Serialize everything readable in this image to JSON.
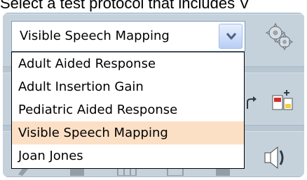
{
  "caption": "Select a test protocol that includes V",
  "protocol_select": {
    "value": "Visible Speech Mapping",
    "options": [
      "Adult Aided Response",
      "Adult Insertion Gain",
      "Pediatric Aided Response",
      "Visible Speech Mapping",
      "Joan Jones"
    ],
    "selected_index": 3
  },
  "icons": {
    "settings": "gear-icon",
    "dropdown": "chevron-down-icon",
    "undo": "curved-arrow-icon",
    "chart": "chart-settings-icon",
    "speaker": "speaker-icon"
  },
  "colors": {
    "panel": "#b7c6d1",
    "selection": "#fce0c6",
    "arrow_button": "#b9cdf5"
  }
}
